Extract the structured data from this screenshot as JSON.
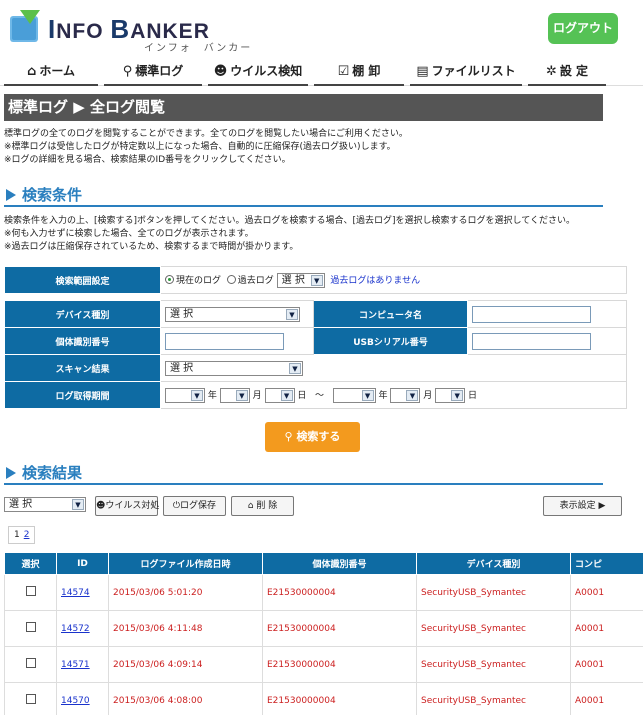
{
  "header": {
    "logo_text_1": "I",
    "logo_text_2": "NFO ",
    "logo_text_3": "B",
    "logo_text_4": "ANKER",
    "logo_kana": "インフォ　バンカー",
    "logout_label": "ログアウト"
  },
  "nav": [
    {
      "icon": "home-icon",
      "glyph": "⌂",
      "label": "ホーム"
    },
    {
      "icon": "search-icon",
      "glyph": "⚲",
      "label": "標準ログ"
    },
    {
      "icon": "virus-icon",
      "glyph": "☻",
      "label": "ウイルス検知"
    },
    {
      "icon": "checklist-icon",
      "glyph": "☑",
      "label": "棚 卸"
    },
    {
      "icon": "list-icon",
      "glyph": "▤",
      "label": "ファイルリスト"
    },
    {
      "icon": "gear-icon",
      "glyph": "✲",
      "label": "設 定"
    }
  ],
  "page_title": "標準ログ ▶ 全ログ閲覧",
  "intro": [
    "標準ログの全てのログを閲覧することができます。全てのログを閲覧したい場合にご利用ください。",
    "※標準ログは受信したログが特定数以上になった場合、自動的に圧縮保存(過去ログ扱い)します。",
    "※ログの詳細を見る場合、検索結果のID番号をクリックしてください。"
  ],
  "search_section": {
    "heading": "検索条件",
    "desc": [
      "検索条件を入力の上、[検索する]ボタンを押してください。過去ログを検索する場合、[過去ログ]を選択し検索するログを選択してください。",
      "※何も入力せずに検索した場合、全てのログが表示されます。",
      "※過去ログは圧縮保存されているため、検索するまで時間が掛かります。"
    ],
    "range_label": "検索範囲設定",
    "radio_current": "現在のログ",
    "radio_past": "過去ログ",
    "past_select": "選 択",
    "no_past_log": "過去ログはありません",
    "device_type_label": "デバイス種別",
    "device_type_value": "選 択",
    "computer_name_label": "コンピュータ名",
    "serial_label": "個体識別番号",
    "usb_serial_label": "USBシリアル番号",
    "scan_result_label": "スキャン結果",
    "scan_result_value": "選 択",
    "date_label": "ログ取得期間",
    "year": "年",
    "month": "月",
    "day": "日",
    "tilde": "～",
    "search_button": "検索する"
  },
  "results_section": {
    "heading": "検索結果",
    "action_select": "選 択",
    "virus_button": "ウイルス対処",
    "save_button": "ログ保存",
    "delete_button": "削 除",
    "display_settings": "表示設定 ▶",
    "pages": [
      "1",
      "2"
    ],
    "columns": [
      "選択",
      "ID",
      "ログファイル作成日時",
      "個体識別番号",
      "デバイス種別",
      "コンピ"
    ],
    "rows": [
      {
        "id": "14574",
        "datetime": "2015/03/06 5:01:20",
        "serial": "E21530000004",
        "device": "SecurityUSB_Symantec",
        "computer": "A0001"
      },
      {
        "id": "14572",
        "datetime": "2015/03/06 4:11:48",
        "serial": "E21530000004",
        "device": "SecurityUSB_Symantec",
        "computer": "A0001"
      },
      {
        "id": "14571",
        "datetime": "2015/03/06 4:09:14",
        "serial": "E21530000004",
        "device": "SecurityUSB_Symantec",
        "computer": "A0001"
      },
      {
        "id": "14570",
        "datetime": "2015/03/06 4:08:00",
        "serial": "E21530000004",
        "device": "SecurityUSB_Symantec",
        "computer": "A0001"
      }
    ]
  },
  "colors": {
    "header_blue": "#0e6ba3",
    "section_blue": "#2a7fbf",
    "logout_green": "#55c255",
    "search_orange": "#f39a1e",
    "title_gray": "#555555",
    "result_red": "#cc2020"
  }
}
